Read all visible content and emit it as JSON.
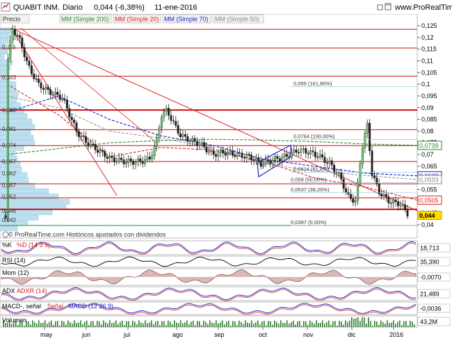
{
  "header": {
    "title": "QUABIT INM.",
    "period": "Diario",
    "quote": "0,044 (-6,38%)",
    "date": "11-ene-2016",
    "site": "www.ProRealTime.com"
  },
  "legend": {
    "precio": "Precio",
    "ma200": "MM (Simple 200)",
    "ma20": "MM (Simple 20)",
    "ma70": "MM (Simple 70)",
    "ma50": "MM (Simple 50)"
  },
  "watermark": "© ProRealTime.com  Históricos ajustados con dividendos",
  "colors": {
    "red": "#e02020",
    "blue": "#1a1acc",
    "green": "#2a8a2a",
    "grey": "#999999",
    "candle_up": "#6ecf6e",
    "volprofile": "#bde0f0"
  },
  "price_axis": [
    "0,125",
    "0,12",
    "0,115",
    "0,11",
    "0,105",
    "0,1",
    "0,095",
    "0,09",
    "0,085",
    "0,08",
    "0,075",
    "0,07",
    "0,065",
    "0,06",
    "0,055",
    "0,05",
    "0,045",
    "0,04"
  ],
  "volume_profile_labels": [
    "0,116",
    "0,103",
    "0,089",
    "0,081",
    "0,074",
    "0,067",
    "0,062",
    "0,057",
    "0,052",
    "0,046",
    "0,042"
  ],
  "fib_labels": [
    "0,099 (161,80%)",
    "0,0764 (100,00%)",
    "0,0624 (61,8%)",
    "0,058 (50,00%)",
    "0,0537 (38,20%)",
    "0,0397 (0,00%)"
  ],
  "price_badges": {
    "ma200": "0,0739",
    "ma70": "0,0609",
    "ma50": "0,0593",
    "ma20": "0,0505",
    "last": "0,044"
  },
  "indicators": [
    {
      "label": "%K",
      "param": "%D (14 3 5)",
      "value": "18,713"
    },
    {
      "label": "RSI (14)",
      "param": "",
      "value": "35,390"
    },
    {
      "label": "Mom (12)",
      "param": "",
      "value": "-0,0070"
    },
    {
      "label": "ADX",
      "param": "ADXR (14)",
      "value": "21,489"
    },
    {
      "label": "MACD-, señal",
      "param": "Señal",
      "param2": "MACD (12 26 9)",
      "value": "-0,0036"
    },
    {
      "label": "Volumen",
      "param": "",
      "value": "43,2M"
    }
  ],
  "months": [
    "may",
    "jun",
    "jul",
    "ago",
    "sep",
    "oct",
    "nov",
    "dic",
    "2016"
  ],
  "chart_data": {
    "type": "candlestick",
    "title": "QUABIT INM.",
    "last": 0.044,
    "change_pct": -6.38,
    "ylim": [
      0.0385,
      0.1265
    ],
    "horizontal_levels": [
      0.1235,
      0.1155,
      0.1035,
      0.089,
      0.0806,
      0.0738,
      0.067,
      0.0575,
      0.0515,
      0.0466,
      0.0397
    ],
    "moving_averages": {
      "ma200": [
        0.07,
        0.0725,
        0.075,
        0.076,
        0.0765,
        0.0762,
        0.0755,
        0.0745,
        0.0739
      ],
      "ma20": [
        0.1,
        0.087,
        0.069,
        0.073,
        0.072,
        0.067,
        0.06,
        0.056,
        0.0505
      ],
      "ma70": [
        0.088,
        0.095,
        0.085,
        0.078,
        0.074,
        0.068,
        0.065,
        0.062,
        0.0609
      ],
      "ma50": [
        0.095,
        0.09,
        0.08,
        0.077,
        0.073,
        0.066,
        0.063,
        0.061,
        0.0593
      ]
    }
  }
}
